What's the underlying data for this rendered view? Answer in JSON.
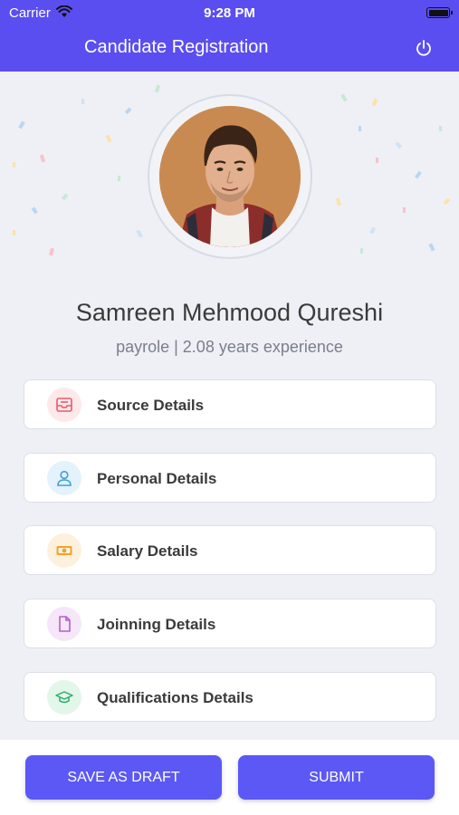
{
  "status_bar": {
    "carrier": "Carrier",
    "time": "9:28 PM"
  },
  "header": {
    "title": "Candidate Registration",
    "background": "#5b4ef0"
  },
  "profile": {
    "name": "Samreen Mehmood Qureshi",
    "subtitle": "payrole | 2.08 years experience"
  },
  "sections": [
    {
      "label": "Source Details",
      "icon": "inbox-icon",
      "color": "#e35d6a",
      "bg": "#fde8ea"
    },
    {
      "label": "Personal Details",
      "icon": "user-icon",
      "color": "#3fa0d8",
      "bg": "#e3f2fb"
    },
    {
      "label": "Salary Details",
      "icon": "money-icon",
      "color": "#f0a22e",
      "bg": "#fdf1de"
    },
    {
      "label": "Joinning Details",
      "icon": "document-icon",
      "color": "#b360c9",
      "bg": "#f5e6f9"
    },
    {
      "label": "Qualifications Details",
      "icon": "graduation-cap-icon",
      "color": "#2faa6a",
      "bg": "#e2f6ea"
    }
  ],
  "actions": {
    "save_draft": "SAVE AS DRAFT",
    "submit": "SUBMIT",
    "accent": "#5b58f5"
  }
}
